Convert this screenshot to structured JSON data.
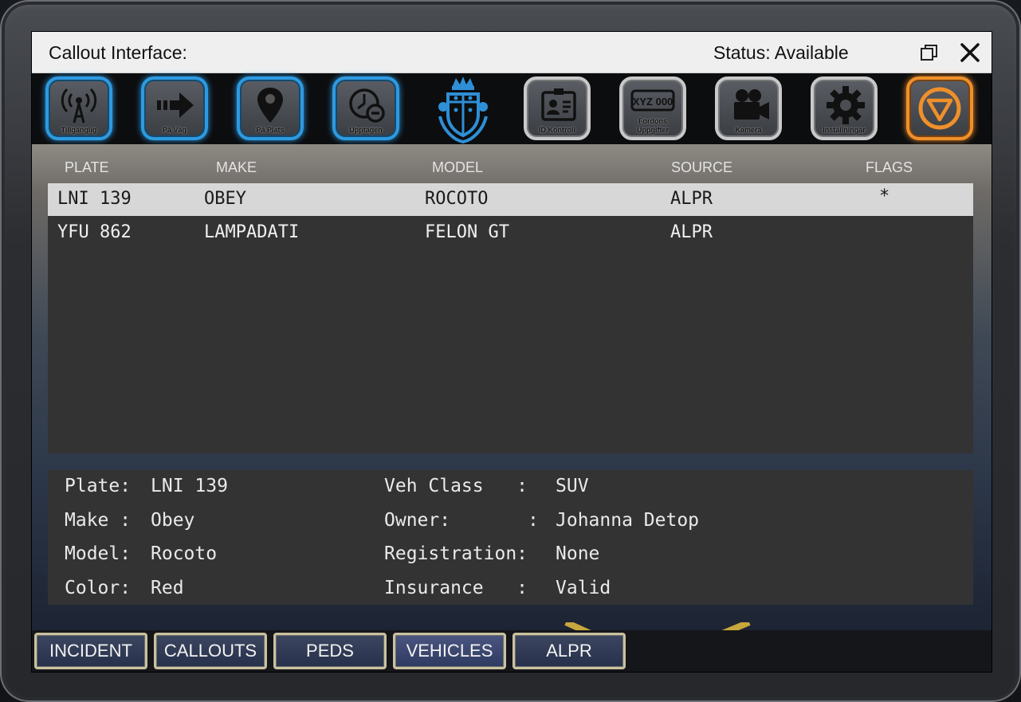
{
  "window": {
    "title": "Callout Interface:",
    "status": "Status: Available"
  },
  "toolbar": {
    "buttons": [
      {
        "label": "Tillgänglig",
        "icon": "radio-signal-icon",
        "style": "blue"
      },
      {
        "label": "På Väg",
        "icon": "arrow-right-icon",
        "style": "blue"
      },
      {
        "label": "På Plats",
        "icon": "map-pin-icon",
        "style": "blue"
      },
      {
        "label": "Upptagen",
        "icon": "clock-busy-icon",
        "style": "blue"
      },
      {
        "label": "ID Kontroll",
        "icon": "id-card-icon",
        "style": "grey"
      },
      {
        "label": "Fordons Uppgifter",
        "plate_text": "XYZ 000",
        "icon": "license-plate-icon",
        "style": "grey"
      },
      {
        "label": "Kamera",
        "icon": "video-camera-icon",
        "style": "grey"
      },
      {
        "label": "Inställningar",
        "icon": "gear-icon",
        "style": "grey"
      },
      {
        "label": "",
        "icon": "panic-triangle-icon",
        "style": "orange"
      }
    ],
    "crest_icon": "police-crest-icon"
  },
  "table": {
    "columns": [
      "PLATE",
      "MAKE",
      "MODEL",
      "SOURCE",
      "FLAGS"
    ],
    "rows": [
      {
        "plate": "LNI 139",
        "make": "OBEY",
        "model": "ROCOTO",
        "source": "ALPR",
        "flags": "*",
        "selected": true
      },
      {
        "plate": "YFU 862",
        "make": "LAMPADATI",
        "model": "FELON GT",
        "source": "ALPR",
        "flags": "",
        "selected": false
      }
    ]
  },
  "details": {
    "left": [
      {
        "label": "Plate: ",
        "value": "LNI 139"
      },
      {
        "label": "Make : ",
        "value": "Obey"
      },
      {
        "label": "Model: ",
        "value": "Rocoto"
      },
      {
        "label": "Color: ",
        "value": "Red"
      }
    ],
    "right": [
      {
        "label": "Veh Class   : ",
        "value": "SUV"
      },
      {
        "label": "Owner:       : ",
        "value": "Johanna Detop"
      },
      {
        "label": "Registration: ",
        "value": "None"
      },
      {
        "label": "Insurance   : ",
        "value": "Valid"
      }
    ]
  },
  "tabs": [
    {
      "label": "INCIDENT",
      "active": false
    },
    {
      "label": "CALLOUTS",
      "active": false
    },
    {
      "label": "PEDS",
      "active": false
    },
    {
      "label": "VEHICLES",
      "active": true
    },
    {
      "label": "ALPR",
      "active": false
    }
  ],
  "colors": {
    "accent_blue": "#2e9ae0",
    "accent_orange": "#f0902a",
    "row_selected": "#d7d7d7",
    "panel": "#333333"
  }
}
